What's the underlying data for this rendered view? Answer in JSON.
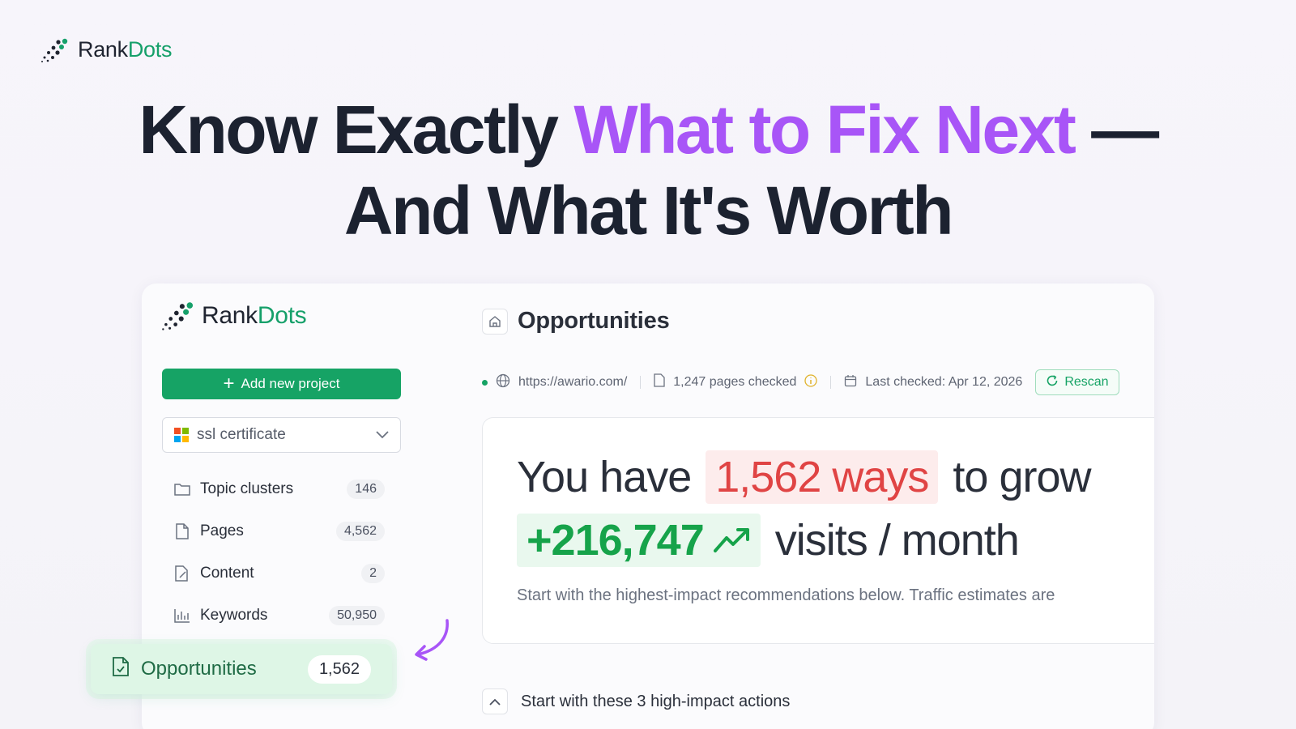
{
  "brand": {
    "name_part1": "Rank",
    "name_part2": "Dots"
  },
  "headline": {
    "part1": "Know Exactly ",
    "accent": "What to Fix Next",
    "part2": " —",
    "line2": "And What It's Worth"
  },
  "app": {
    "brand_part1": "Rank",
    "brand_part2": "Dots",
    "add_button": "Add new project",
    "project_select": "ssl certificate",
    "nav": [
      {
        "label": "Topic clusters",
        "count": "146",
        "icon": "folder-icon"
      },
      {
        "label": "Pages",
        "count": "4,562",
        "icon": "file-icon"
      },
      {
        "label": "Content",
        "count": "2",
        "icon": "edit-file-icon"
      },
      {
        "label": "Keywords",
        "count": "50,950",
        "icon": "bar-chart-icon"
      }
    ],
    "highlight_item": {
      "label": "Opportunities",
      "count": "1,562"
    },
    "page_title": "Opportunities",
    "meta": {
      "url": "https://awario.com/",
      "pages_checked": "1,247 pages checked",
      "last_checked": "Last checked: Apr 12, 2026",
      "rescan": "Rescan"
    },
    "summary": {
      "you_have": "You have",
      "ways": "1,562 ways",
      "to_grow": "to grow",
      "visits": "+216,747",
      "per_month": "visits / month",
      "subtitle": "Start with the highest-impact recommendations below. Traffic estimates are"
    },
    "actions_title": "Start with these 3 high-impact actions"
  },
  "colors": {
    "brand_green": "#16a365",
    "accent_purple": "#a855f7",
    "ways_red": "#e04444",
    "visits_green": "#16a34a"
  }
}
